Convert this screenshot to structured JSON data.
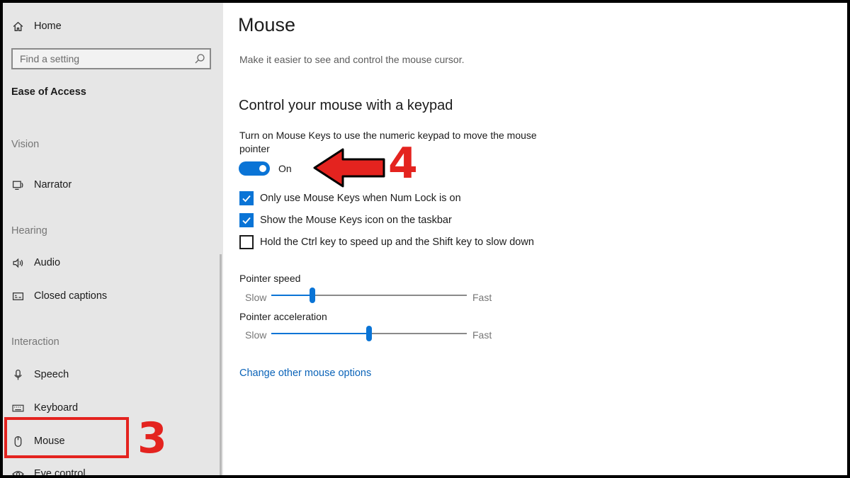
{
  "sidebar": {
    "home": {
      "label": "Home",
      "icon": "home-icon"
    },
    "search": {
      "placeholder": "Find a setting",
      "icon": "search-icon"
    },
    "section_title": "Ease of Access",
    "groups": {
      "vision": "Vision",
      "hearing": "Hearing",
      "interaction": "Interaction"
    },
    "items": {
      "narrator": {
        "label": "Narrator",
        "icon": "narrator-icon"
      },
      "audio": {
        "label": "Audio",
        "icon": "speaker-icon"
      },
      "closed_captions": {
        "label": "Closed captions",
        "icon": "captions-icon"
      },
      "speech": {
        "label": "Speech",
        "icon": "microphone-icon"
      },
      "keyboard": {
        "label": "Keyboard",
        "icon": "keyboard-icon"
      },
      "mouse": {
        "label": "Mouse",
        "icon": "mouse-icon",
        "selected": true
      },
      "eye_control": {
        "label": "Eye control",
        "icon": "eye-icon"
      }
    }
  },
  "annotations": {
    "step3": "3",
    "step4": "4",
    "accent": "#e4231f"
  },
  "main": {
    "title": "Mouse",
    "subtitle": "Make it easier to see and control the mouse cursor.",
    "section_title": "Control your mouse with a keypad",
    "mouse_keys_desc": "Turn on Mouse Keys to use the numeric keypad to move the mouse pointer",
    "toggle": {
      "state_label": "On",
      "on": true
    },
    "checkboxes": [
      {
        "label": "Only use Mouse Keys when Num Lock is on",
        "checked": true
      },
      {
        "label": "Show the Mouse Keys icon on the taskbar",
        "checked": true
      },
      {
        "label": "Hold the Ctrl key to speed up and the Shift key to slow down",
        "checked": false
      }
    ],
    "sliders": [
      {
        "label": "Pointer speed",
        "min_label": "Slow",
        "max_label": "Fast",
        "value": 0.21
      },
      {
        "label": "Pointer acceleration",
        "min_label": "Slow",
        "max_label": "Fast",
        "value": 0.5
      }
    ],
    "link": "Change other mouse options"
  },
  "colors": {
    "accent_blue": "#0a74d6",
    "sidebar_bg": "#e6e6e6",
    "link": "#0a63b8"
  }
}
